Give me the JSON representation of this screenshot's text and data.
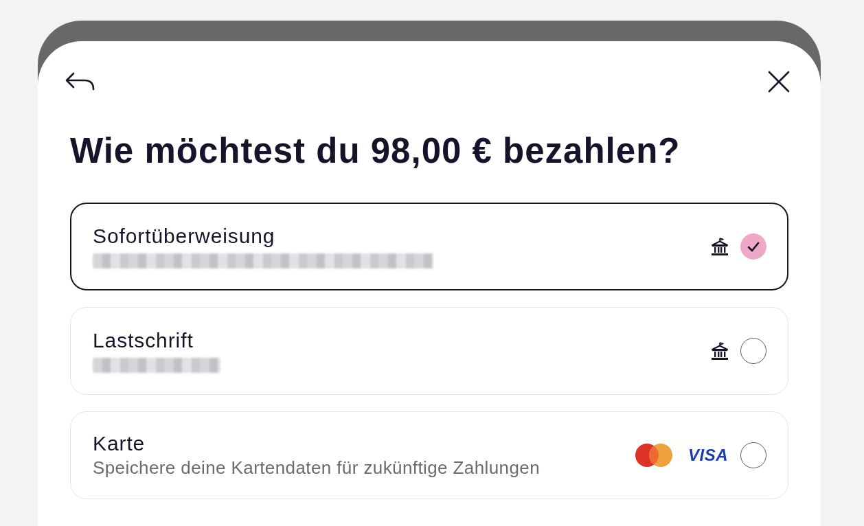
{
  "title": "Wie möchtest du 98,00 € bezahlen?",
  "options": [
    {
      "kind": "bank",
      "name": "Sofortüberweisung",
      "detail": {
        "kind": "blurred_long"
      },
      "selected": true
    },
    {
      "kind": "bank",
      "name": "Lastschrift",
      "detail": {
        "kind": "blurred_short"
      },
      "selected": false
    },
    {
      "kind": "card",
      "name": "Karte",
      "description": "Speichere deine Kartendaten für zukünftige Zahlungen",
      "selected": false,
      "card_brands": [
        {
          "kind": "mastercard"
        },
        {
          "kind": "wordmark",
          "text": "VISA"
        }
      ]
    }
  ]
}
